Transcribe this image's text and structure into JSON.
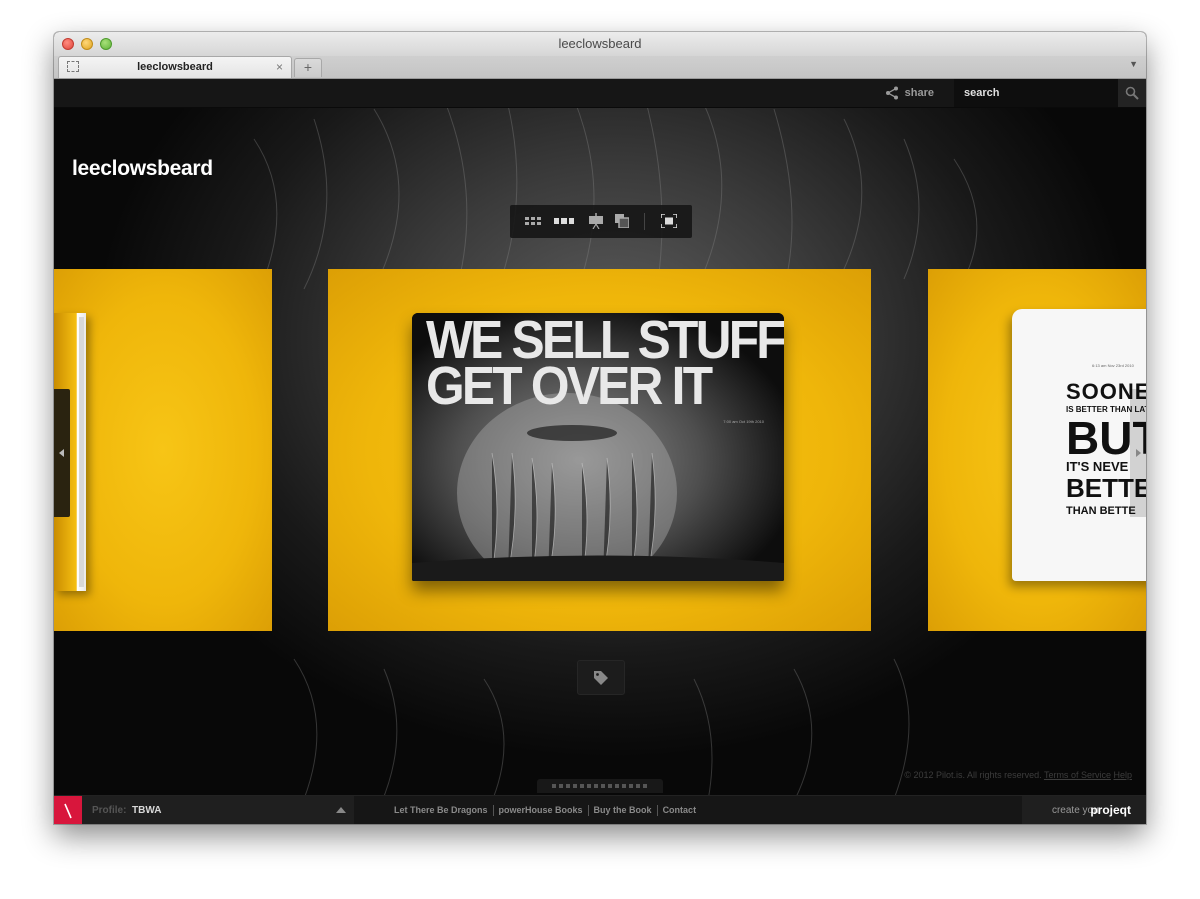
{
  "window": {
    "title": "leeclowsbeard"
  },
  "tabs": [
    {
      "label": "leeclowsbeard",
      "close": "×"
    }
  ],
  "new_tab": "+",
  "topbar": {
    "share_label": "share",
    "search_placeholder": "search"
  },
  "site": {
    "title": "leeclowsbeard"
  },
  "center_spread": {
    "line1": "WE SELL STUFF",
    "line2": "GET OVER IT",
    "date": "7:00 am Oct 19th 2010"
  },
  "right_book": {
    "date": "6:13 am Nov 23rd 2010",
    "line1": "SOONE",
    "line2": "IS BETTER THAN LAT",
    "line3": "BUT",
    "line4": "IT'S NEVE",
    "line5": "BETTE",
    "line6": "THAN BETTE"
  },
  "footer": {
    "copyright": "© 2012 Pilot.is. All rights reserved.",
    "terms": "Terms of Service",
    "help": "Help",
    "profile_label": "Profile:",
    "profile_name": "TBWA",
    "links": [
      "Let There Be Dragons",
      "powerHouse Books",
      "Buy the Book",
      "Contact"
    ],
    "create_prefix": "create your",
    "create_brand": "projeqt"
  },
  "colors": {
    "accent_yellow": "#f2bb0c",
    "brand_red": "#d8163c",
    "bar_dark": "#161616"
  }
}
